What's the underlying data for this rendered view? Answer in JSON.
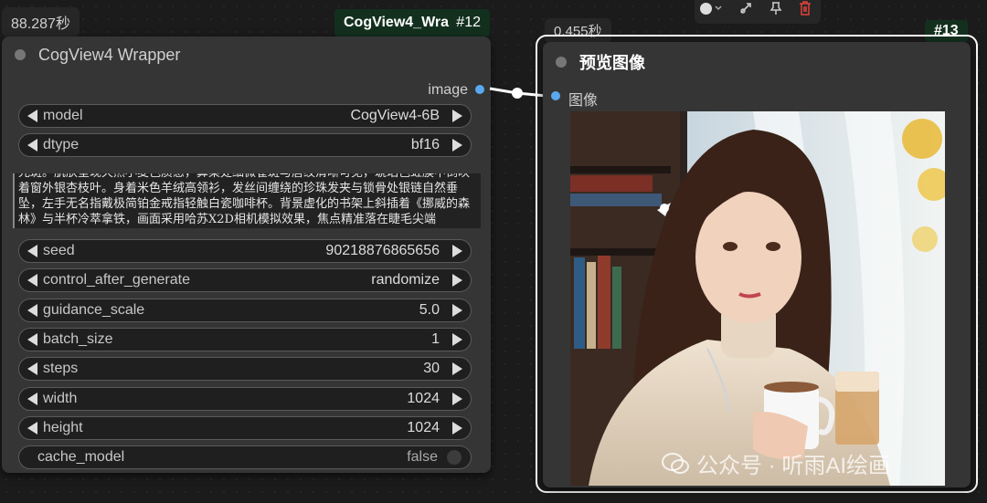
{
  "node12": {
    "timer": "88.287秒",
    "title_tag": "CogView4_Wra",
    "id_tag": "#12",
    "header_title": "CogView4 Wrapper",
    "output_label": "image",
    "model": {
      "label": "model",
      "value": "CogView4-6B"
    },
    "dtype": {
      "label": "dtype",
      "value": "bf16"
    },
    "prompt": "光斑。肌肤呈现天然小麦色质感，鼻梁处细微雀斑与唇纹清晰可见，琥珀色虹膜中倒映着窗外银杏枝叶。身着米色羊绒高领衫，发丝间缠绕的珍珠发夹与锁骨处银链自然垂坠，左手无名指戴极简铂金戒指轻触白瓷咖啡杯。背景虚化的书架上斜插着《挪威的森林》与半杯冷萃拿铁，画面采用哈苏X2D相机模拟效果，焦点精准落在睫毛尖端",
    "seed": {
      "label": "seed",
      "value": "90218876865656"
    },
    "control_after_generate": {
      "label": "control_after_generate",
      "value": "randomize"
    },
    "guidance_scale": {
      "label": "guidance_scale",
      "value": "5.0"
    },
    "batch_size": {
      "label": "batch_size",
      "value": "1"
    },
    "steps": {
      "label": "steps",
      "value": "30"
    },
    "width": {
      "label": "width",
      "value": "1024"
    },
    "height": {
      "label": "height",
      "value": "1024"
    },
    "cache_model": {
      "label": "cache_model",
      "value": "false"
    }
  },
  "node13": {
    "timer": "0.455秒",
    "id_tag": "#13",
    "header_title": "预览图像",
    "input_label": "图像"
  },
  "watermark": "公众号 · 听雨AI绘画",
  "colors": {
    "accent": "#5aa9f0",
    "selection": "#ffffff",
    "title_bg": "#13301e",
    "delete": "#e0443a"
  }
}
